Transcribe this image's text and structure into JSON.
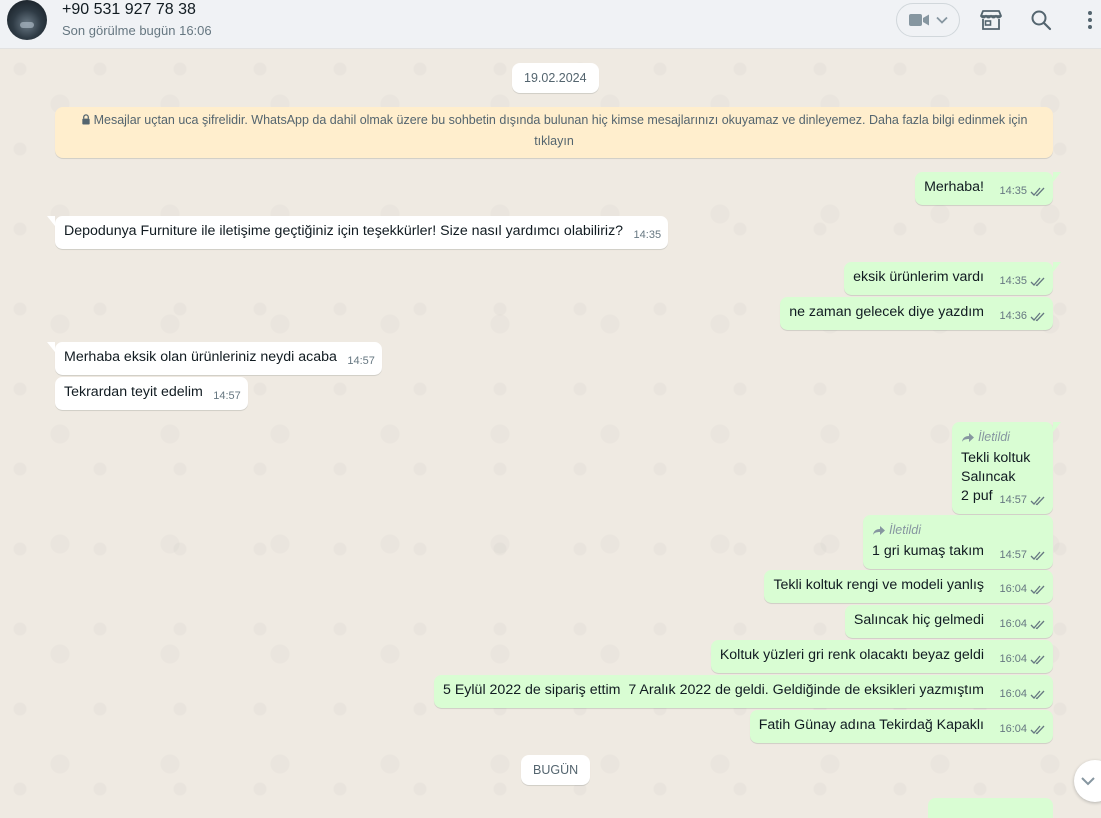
{
  "header": {
    "contact_name": "+90 531 927 78 38",
    "last_seen": "Son görülme bugün 16:06",
    "icons": [
      "video-call-icon",
      "chevron-down-icon",
      "store-icon",
      "search-icon",
      "menu-icon"
    ]
  },
  "chat": {
    "date_1": "19.02.2024",
    "encryption_notice": "Mesajlar uçtan uca şifrelidir. WhatsApp da dahil olmak üzere bu sohbetin dışında bulunan hiç kimse mesajlarınızı okuyamaz ve dinleyemez. Daha fazla bilgi edinmek için tıklayın",
    "date_2": "BUGÜN",
    "forwarded_label": "İletildi",
    "messages": [
      {
        "dir": "out",
        "text": "Merhaba!",
        "time": "14:35"
      },
      {
        "dir": "in",
        "text": "Depodunya Furniture ile iletişime geçtiğiniz için teşekkürler! Size nasıl yardımcı olabiliriz?",
        "time": "14:35"
      },
      {
        "dir": "out",
        "text": "eksik ürünlerim vardı",
        "time": "14:35"
      },
      {
        "dir": "out",
        "text": "ne zaman gelecek diye yazdım",
        "time": "14:36"
      },
      {
        "dir": "in",
        "text": "Merhaba eksik olan ürünleriniz neydi acaba",
        "time": "14:57"
      },
      {
        "dir": "in",
        "text": "Tekrardan teyit edelim",
        "time": "14:57"
      },
      {
        "dir": "out",
        "forwarded": true,
        "lines": [
          "Tekli koltuk",
          "Salıncak",
          "2 puf"
        ],
        "time": "14:57"
      },
      {
        "dir": "out",
        "forwarded": true,
        "text": "1 gri kumaş takım",
        "time": "14:57"
      },
      {
        "dir": "out",
        "text": "Tekli koltuk rengi ve modeli yanlış",
        "time": "16:04"
      },
      {
        "dir": "out",
        "text": "Salıncak hiç gelmedi",
        "time": "16:04"
      },
      {
        "dir": "out",
        "text": "Koltuk yüzleri gri renk olacaktı beyaz geldi",
        "time": "16:04"
      },
      {
        "dir": "out",
        "text": "5 Eylül 2022 de sipariş ettim  7 Aralık 2022 de geldi. Geldiğinde de eksikleri yazmıştım",
        "time": "16:04"
      },
      {
        "dir": "out",
        "text": "Fatih Günay adına Tekirdağ Kapaklı",
        "time": "16:04"
      }
    ]
  },
  "colors": {
    "outgoing_bubble": "#d9fdd3",
    "incoming_bubble": "#ffffff",
    "chat_background": "#efeae2",
    "notice_background": "#ffeecd",
    "read_tick": "#667781"
  }
}
